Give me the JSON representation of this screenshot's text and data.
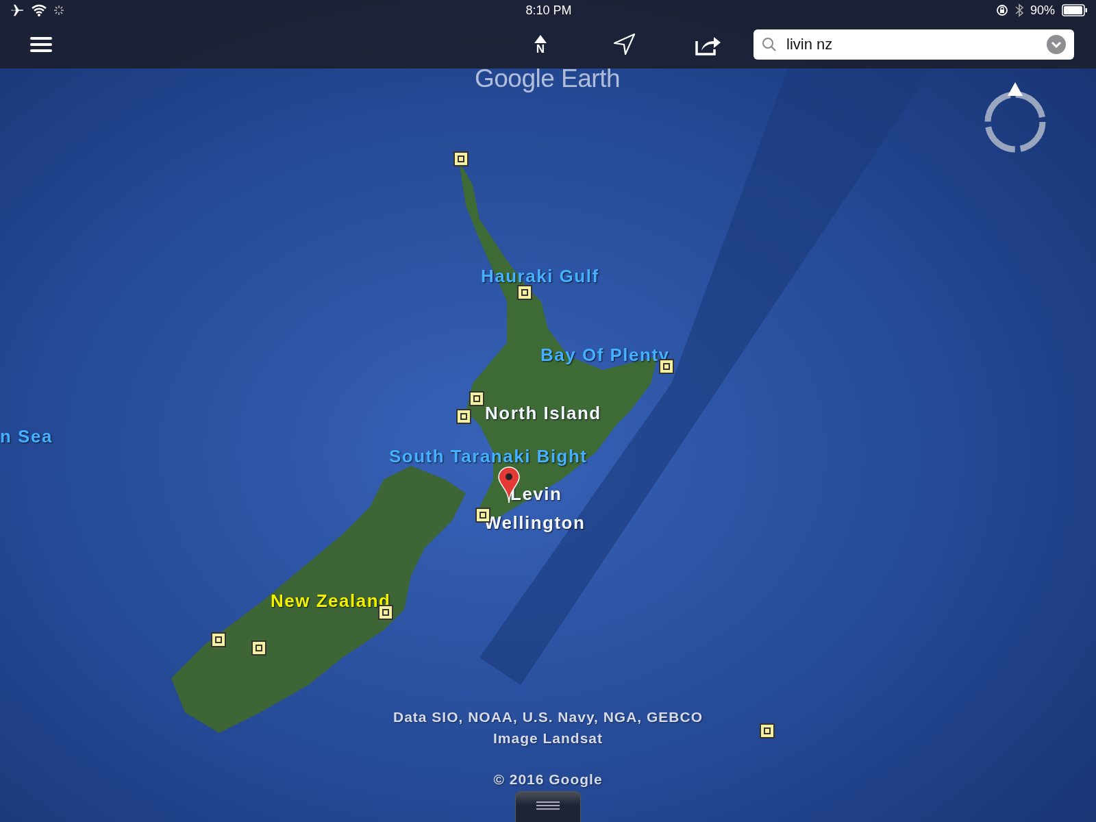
{
  "status_bar": {
    "time": "8:10 PM",
    "battery": "90%"
  },
  "toolbar": {
    "north_label": "N",
    "search": {
      "value": "livin nz"
    }
  },
  "map": {
    "logo": "Google Earth",
    "labels": [
      {
        "text": "Hauraki Gulf",
        "kind": "water"
      },
      {
        "text": "Bay Of Plenty",
        "kind": "water"
      },
      {
        "text": "North Island",
        "kind": "place"
      },
      {
        "text": "South Taranaki Bight",
        "kind": "water"
      },
      {
        "text": "Levin",
        "kind": "place"
      },
      {
        "text": "Wellington",
        "kind": "place"
      },
      {
        "text": "New Zealand",
        "kind": "country"
      },
      {
        "text": "n Sea",
        "kind": "water"
      }
    ],
    "attribution": [
      "Data SIO, NOAA, U.S. Navy, NGA, GEBCO",
      "Image Landsat"
    ],
    "copyright": "© 2016 Google"
  }
}
